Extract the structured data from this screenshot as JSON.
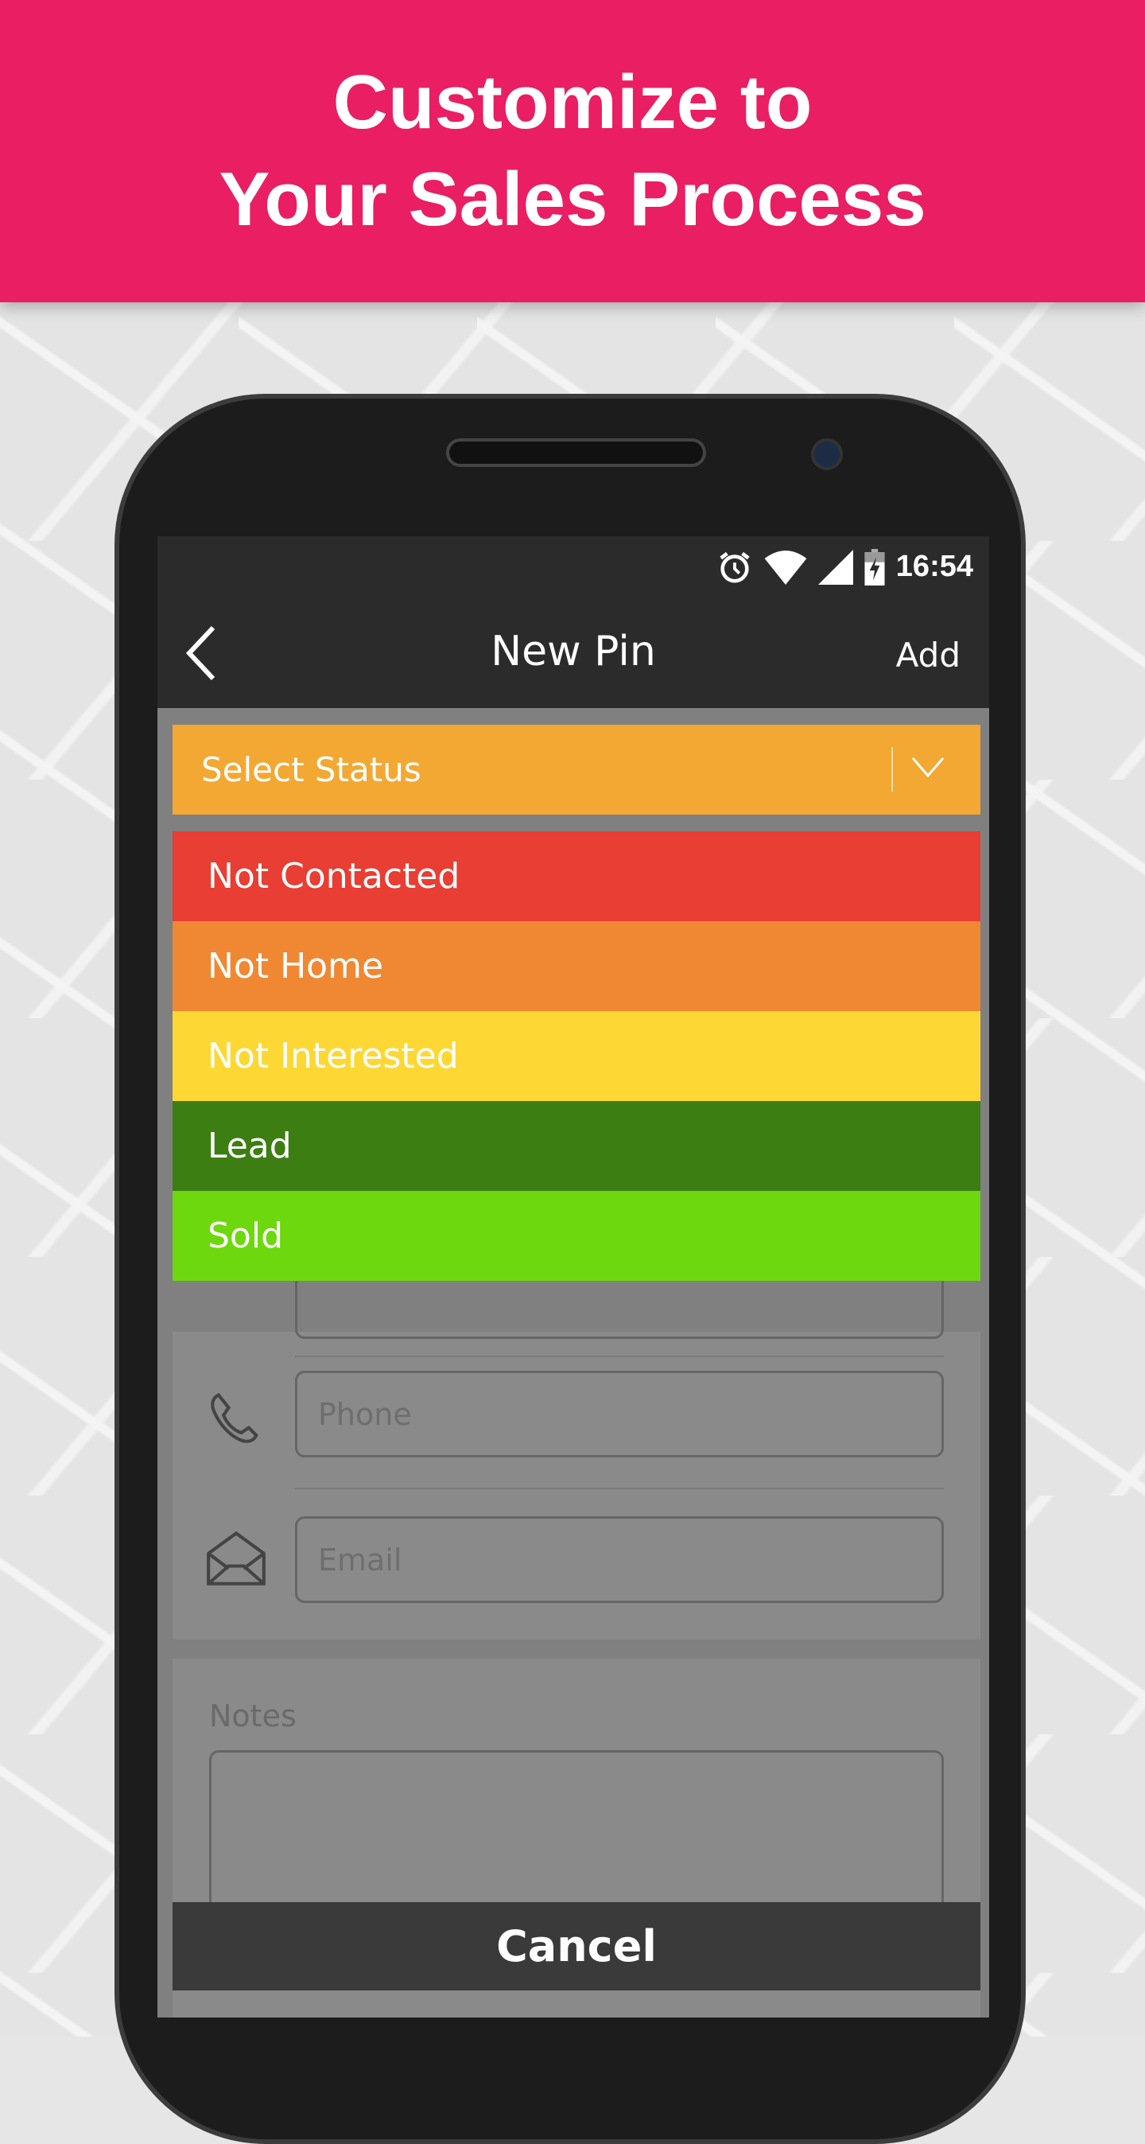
{
  "banner": {
    "line1": "Customize to",
    "line2": "Your Sales Process",
    "color": "#e91e63"
  },
  "status_bar": {
    "time": "16:54",
    "icons": [
      "alarm-icon",
      "wifi-icon",
      "signal-icon",
      "battery-charging-icon"
    ]
  },
  "toolbar": {
    "title": "New Pin",
    "action": "Add",
    "back_icon": "chevron-left-icon"
  },
  "status_select": {
    "label": "Select Status",
    "color": "#f2a833"
  },
  "status_options": [
    {
      "label": "Not Contacted",
      "color": "#e83e33"
    },
    {
      "label": "Not Home",
      "color": "#f08833"
    },
    {
      "label": "Not Interested",
      "color": "#fdd835"
    },
    {
      "label": "Lead",
      "color": "#3d7e13"
    },
    {
      "label": "Sold",
      "color": "#6dd80e"
    }
  ],
  "form": {
    "phone_placeholder": "Phone",
    "email_placeholder": "Email",
    "notes_label": "Notes"
  },
  "cancel_label": "Cancel"
}
